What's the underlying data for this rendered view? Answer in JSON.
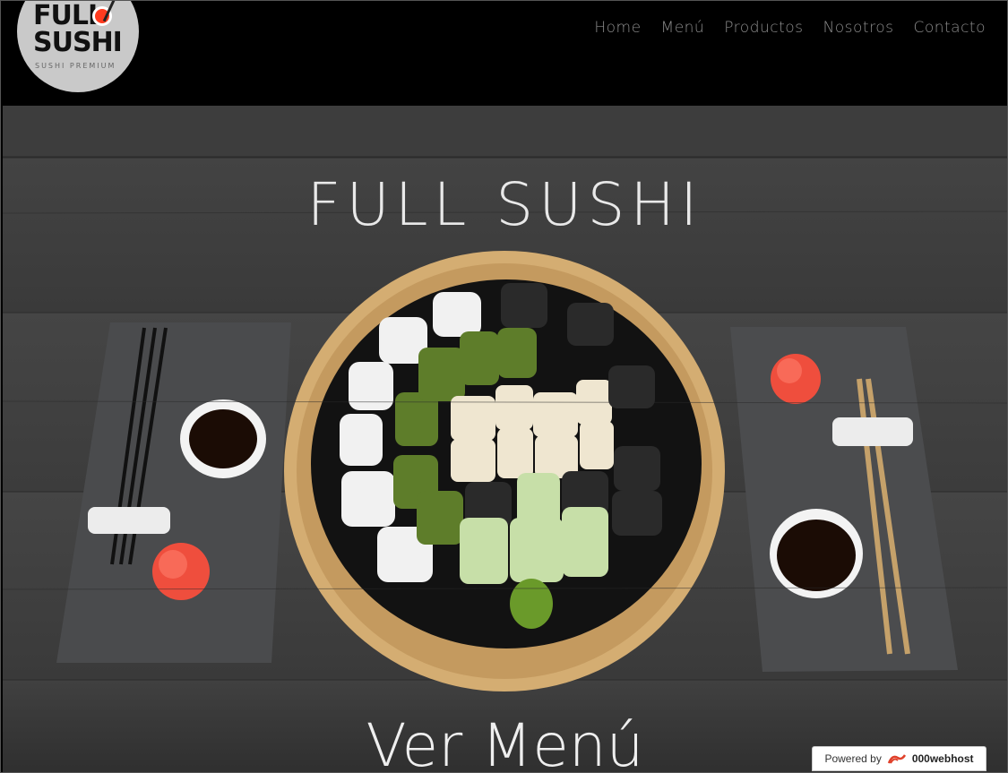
{
  "logo": {
    "line1": "FULL",
    "line2": "SUSHI",
    "tagline": "SUSHI PREMIUM"
  },
  "nav": {
    "items": [
      {
        "label": "Home"
      },
      {
        "label": "Menú"
      },
      {
        "label": "Productos"
      },
      {
        "label": "Nosotros"
      },
      {
        "label": "Contacto"
      }
    ]
  },
  "hero": {
    "title": "FULL SUSHI",
    "cta": "Ver Menú"
  },
  "badge": {
    "prefix": "Powered by",
    "brand": "000webhost"
  },
  "colors": {
    "accent": "#ff3b1f",
    "nav_text": "#8d8d8d",
    "hero_text": "#e9e9e9"
  }
}
